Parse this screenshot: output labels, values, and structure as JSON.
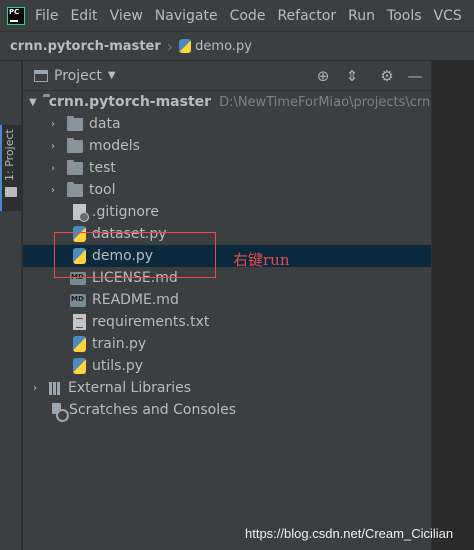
{
  "menubar": {
    "logo_text": "PC",
    "items": [
      "File",
      "Edit",
      "View",
      "Navigate",
      "Code",
      "Refactor",
      "Run",
      "Tools",
      "VCS"
    ]
  },
  "breadcrumb": {
    "root": "crnn.pytorch-master",
    "file": "demo.py"
  },
  "tool_stripe": {
    "project_tab_label": "1: Project"
  },
  "project_panel": {
    "title": "Project",
    "root": {
      "name": "crnn.pytorch-master",
      "path": "D:\\NewTimeForMiao\\projects\\crnn"
    },
    "folders": [
      "data",
      "models",
      "test",
      "tool"
    ],
    "files": [
      ".gitignore",
      "dataset.py",
      "demo.py",
      "LICENSE.md",
      "README.md",
      "requirements.txt",
      "train.py",
      "utils.py"
    ],
    "external_libraries": "External Libraries",
    "scratches": "Scratches and Consoles",
    "selected_file": "demo.py"
  },
  "annotation": {
    "text": "右键run",
    "color": "#e84b4b"
  },
  "watermark": "https://blog.csdn.net/Cream_Cicilian",
  "colors": {
    "panel_bg": "#3c3f41",
    "editor_bg": "#2b2b2b",
    "selection_bg": "#0d293e",
    "text": "#bbbbbb"
  }
}
